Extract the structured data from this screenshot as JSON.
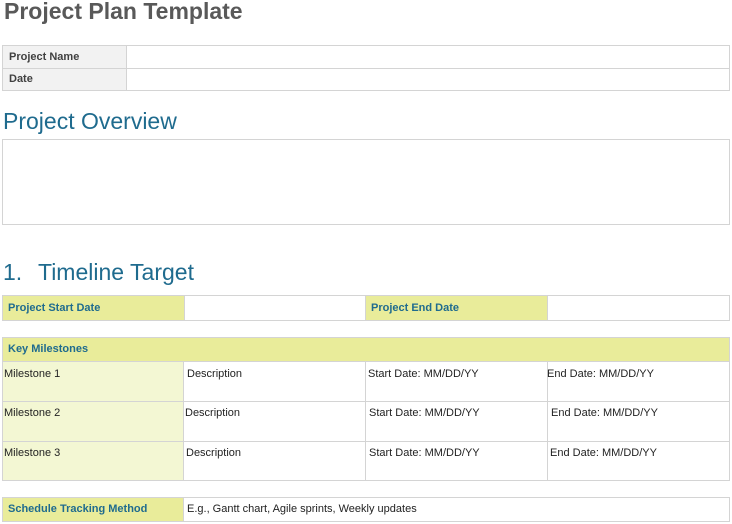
{
  "document": {
    "title": "Project Plan Template"
  },
  "info_table": {
    "rows": [
      {
        "label": "Project Name",
        "value": ""
      },
      {
        "label": "Date",
        "value": ""
      }
    ]
  },
  "overview": {
    "heading": "Project Overview",
    "body": ""
  },
  "timeline": {
    "number": "1.",
    "heading": "Timeline Target",
    "start_label": "Project Start Date",
    "start_value": "",
    "end_label": "Project End Date",
    "end_value": ""
  },
  "milestones": {
    "header": "Key Milestones",
    "rows": [
      {
        "name": "Milestone 1",
        "description": "Description",
        "start": "Start Date: MM/DD/YY",
        "end": "End Date: MM/DD/YY"
      },
      {
        "name": "Milestone 2",
        "description": "Description",
        "start": "Start Date: MM/DD/YY",
        "end": "End Date: MM/DD/YY"
      },
      {
        "name": "Milestone 3",
        "description": "Description",
        "start": "Start Date: MM/DD/YY",
        "end": "End Date: MM/DD/YY"
      }
    ]
  },
  "tracking": {
    "label": "Schedule Tracking Method",
    "value": "E.g., Gantt chart, Agile sprints, Weekly updates"
  },
  "colors": {
    "heading_blue": "#1f6b8e",
    "yellow_fill": "#e9ec9a",
    "pale_fill": "#f3f7d3",
    "grey_label_fill": "#f2f2f2"
  }
}
